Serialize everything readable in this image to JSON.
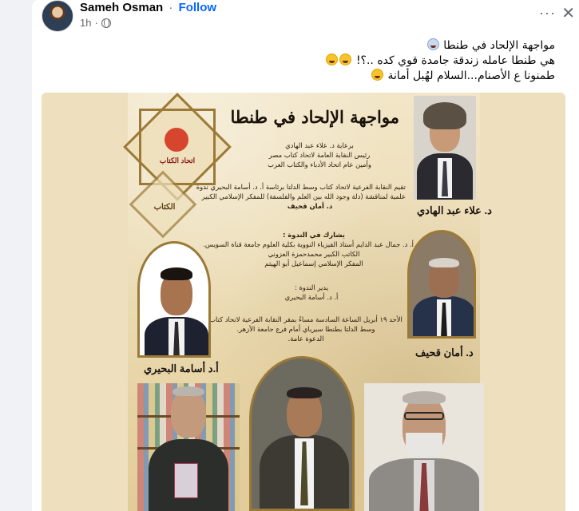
{
  "post": {
    "author": "Sameh Osman",
    "separator": "·",
    "follow_label": "Follow",
    "time": "1h",
    "more_label": "···",
    "close_label": "✕",
    "text_lines": [
      "مواجهة الإلحاد في طنطا",
      "هي طنطا عامله زندقة جامدة قوي كده ..؟!",
      "طمنونا ع الأصنام...السلام لهُبل أمانة"
    ]
  },
  "poster": {
    "title": "مواجهة الإلحاد في طنطا",
    "logo_label": "اتحاد الكتاب",
    "logo_sub": "الكتاب",
    "patronage": [
      "برعاية د. علاء عبد الهادي",
      "رئيس النقابة العامة لاتحاد كتاب مصر",
      "وأمين عام اتحاد الأدباء والكتاب العرب"
    ],
    "organizer": [
      "تقيم النقابة الفرعية لاتحاد كتاب وسط الدلتا برئاسة أ. د. أسامة البحيري ندوة",
      "علمية لمناقشة (دلة وجود الله بين العلم والفلسفة) للمفكر الإسلامي الكبير",
      "د. أمان قحيف"
    ],
    "participants": [
      "يشارك في الندوة :",
      "أ. د. جمال عبد الدايم أستاذ الفيزياء النووية بكلية العلوم جامعة قناة السويس.",
      "الكاتب الكبير محمدحمزة العزوني",
      "المفكر الإسلامي إسماعيل أبو الهيثم"
    ],
    "moderator": [
      "يدير الندوة :",
      "أ. د. أسامة البحيري"
    ],
    "schedule": [
      "الأحد ١٩ أبريل الساعة السادسة مساءً بمقر النقابة الفرعية لاتحاد كتاب",
      "وسط الدلتا بطنطا سيرباي أمام فرع جامعة الأزهر.",
      "الدعوة عامة."
    ],
    "captions": {
      "alaa": "د. علاء عبد الهادي",
      "aman": "د. أمان قحيف",
      "osama": "أ.د أسامة البحيري"
    }
  }
}
